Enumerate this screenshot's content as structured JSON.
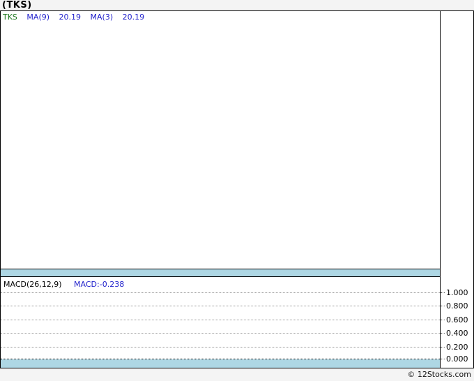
{
  "header": {
    "title": "(TKS)"
  },
  "price_panel": {
    "legend": {
      "symbol": "TKS",
      "items": [
        {
          "label": "MA(9)",
          "value": "20.19"
        },
        {
          "label": "MA(3)",
          "value": "20.19"
        }
      ]
    }
  },
  "macd_panel": {
    "indicator_label": "MACD(26,12,9)",
    "indicator_value": "MACD:-0.238",
    "axis_ticks": [
      "1.000",
      "0.800",
      "0.600",
      "0.400",
      "0.200",
      "0.000"
    ]
  },
  "footer": {
    "credit": "© 12Stocks.com"
  },
  "colors": {
    "band_blue": "#aed7e4",
    "legend_symbol_green": "#217a21",
    "legend_blue": "#2222cc",
    "frame_black": "#000000",
    "page_gray": "#f4f4f4",
    "grid_gray": "#999999"
  },
  "chart_data": [
    {
      "type": "line",
      "title": "(TKS) price panel",
      "series": [
        {
          "name": "TKS",
          "values": []
        },
        {
          "name": "MA(9)",
          "last_value": 20.19,
          "values": []
        },
        {
          "name": "MA(3)",
          "last_value": 20.19,
          "values": []
        }
      ],
      "x": [],
      "legend_position": "top-left",
      "grid": "off",
      "note_visible_state": "panel is blank - no plotted price data visible"
    },
    {
      "type": "line",
      "title": "MACD(26,12,9)",
      "series": [
        {
          "name": "MACD",
          "last_value": -0.238,
          "values": []
        }
      ],
      "x": [],
      "ylim": [
        0.0,
        1.0
      ],
      "ytick_labels": [
        "1.000",
        "0.800",
        "0.600",
        "0.400",
        "0.200",
        "0.000"
      ],
      "yaxis_position": "right",
      "grid": "dotted horizontal gridlines",
      "note_visible_state": "panel is blank - no plotted MACD line visible"
    }
  ]
}
